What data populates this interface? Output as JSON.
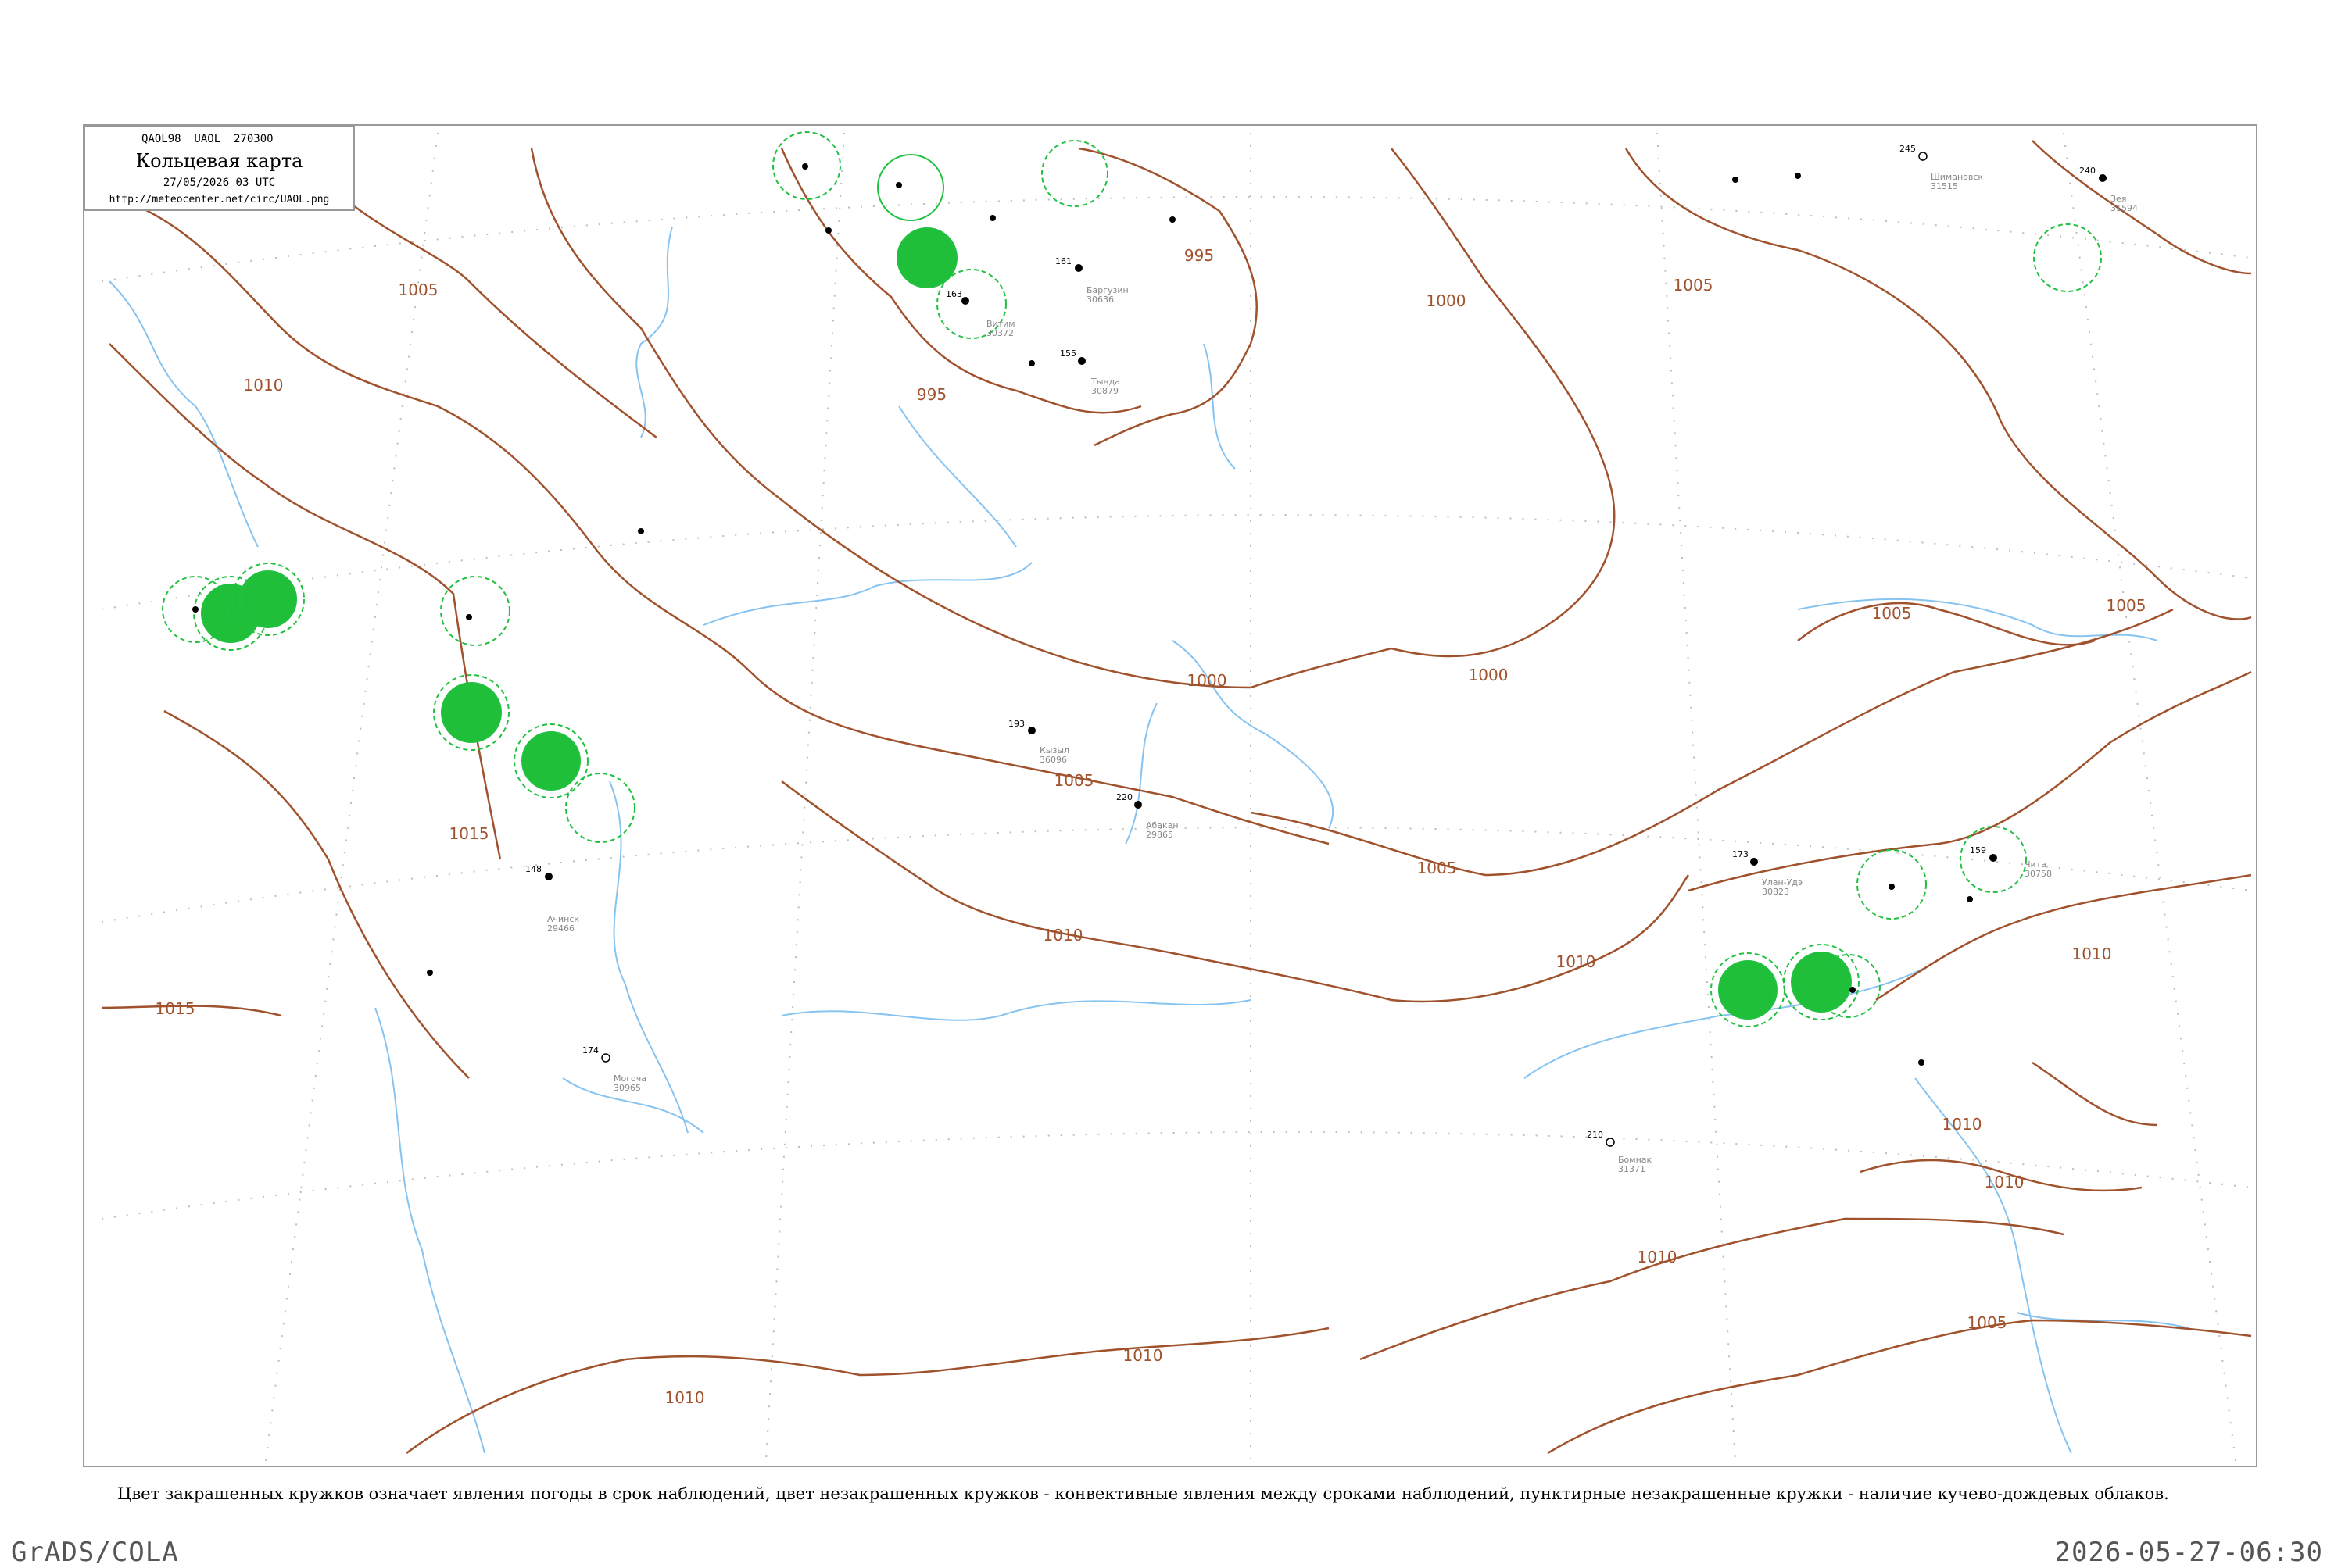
{
  "header": {
    "code_line": "QAOL98  UAOL  270300",
    "title": "Кольцевая карта",
    "datetime": "27/05/2026 03 UTC",
    "url": "http://meteocenter.net/circ/UAOL.png"
  },
  "caption": "Цвет закрашенных кружков означает явления погоды в срок наблюдений, цвет незакрашенных кружков - конвективные явления между сроками наблюдений, пунктирные незакрашенные кружки - наличие кучево-дождевых облаков.",
  "footer": {
    "software": "GrADS/COLA",
    "timestamp": "2026-05-27-06:30"
  },
  "colors": {
    "isobar": "#a0522d",
    "water": "#87c3f0",
    "convective_fill": "#1fbf3a",
    "cb_dashed": "#22c040",
    "grid": "#bbbbbb",
    "frame": "#999999"
  },
  "isobar_labels": [
    "1005",
    "1010",
    "1015",
    "1015",
    "995",
    "1000",
    "1000",
    "1000",
    "1005",
    "1005",
    "1005",
    "1005",
    "1010",
    "1010",
    "1010",
    "1010",
    "1010",
    "1010",
    "1005",
    "995",
    "1005"
  ],
  "stations": [
    {
      "name": "Ачинск",
      "id": "29466",
      "pressure": "148"
    },
    {
      "name": "Кызыл",
      "id": "36096",
      "pressure": "193"
    },
    {
      "name": "Абакан",
      "id": "29865",
      "pressure": "220"
    },
    {
      "name": "Улан-Удэ",
      "id": "30823",
      "pressure": "173"
    },
    {
      "name": "Чита",
      "id": "30758",
      "pressure": "159"
    },
    {
      "name": "Баргузин",
      "id": "30636",
      "pressure": "161"
    },
    {
      "name": "Витим",
      "id": "30372",
      "pressure": "163"
    },
    {
      "name": "Бомнак",
      "id": "31371",
      "pressure": "210"
    },
    {
      "name": "Тында",
      "id": "30879",
      "pressure": "155"
    },
    {
      "name": "Могоча",
      "id": "30965",
      "pressure": "174"
    },
    {
      "name": "Шимановск",
      "id": "31515",
      "pressure": "245"
    },
    {
      "name": "Зея",
      "id": "31594",
      "pressure": "240"
    }
  ]
}
